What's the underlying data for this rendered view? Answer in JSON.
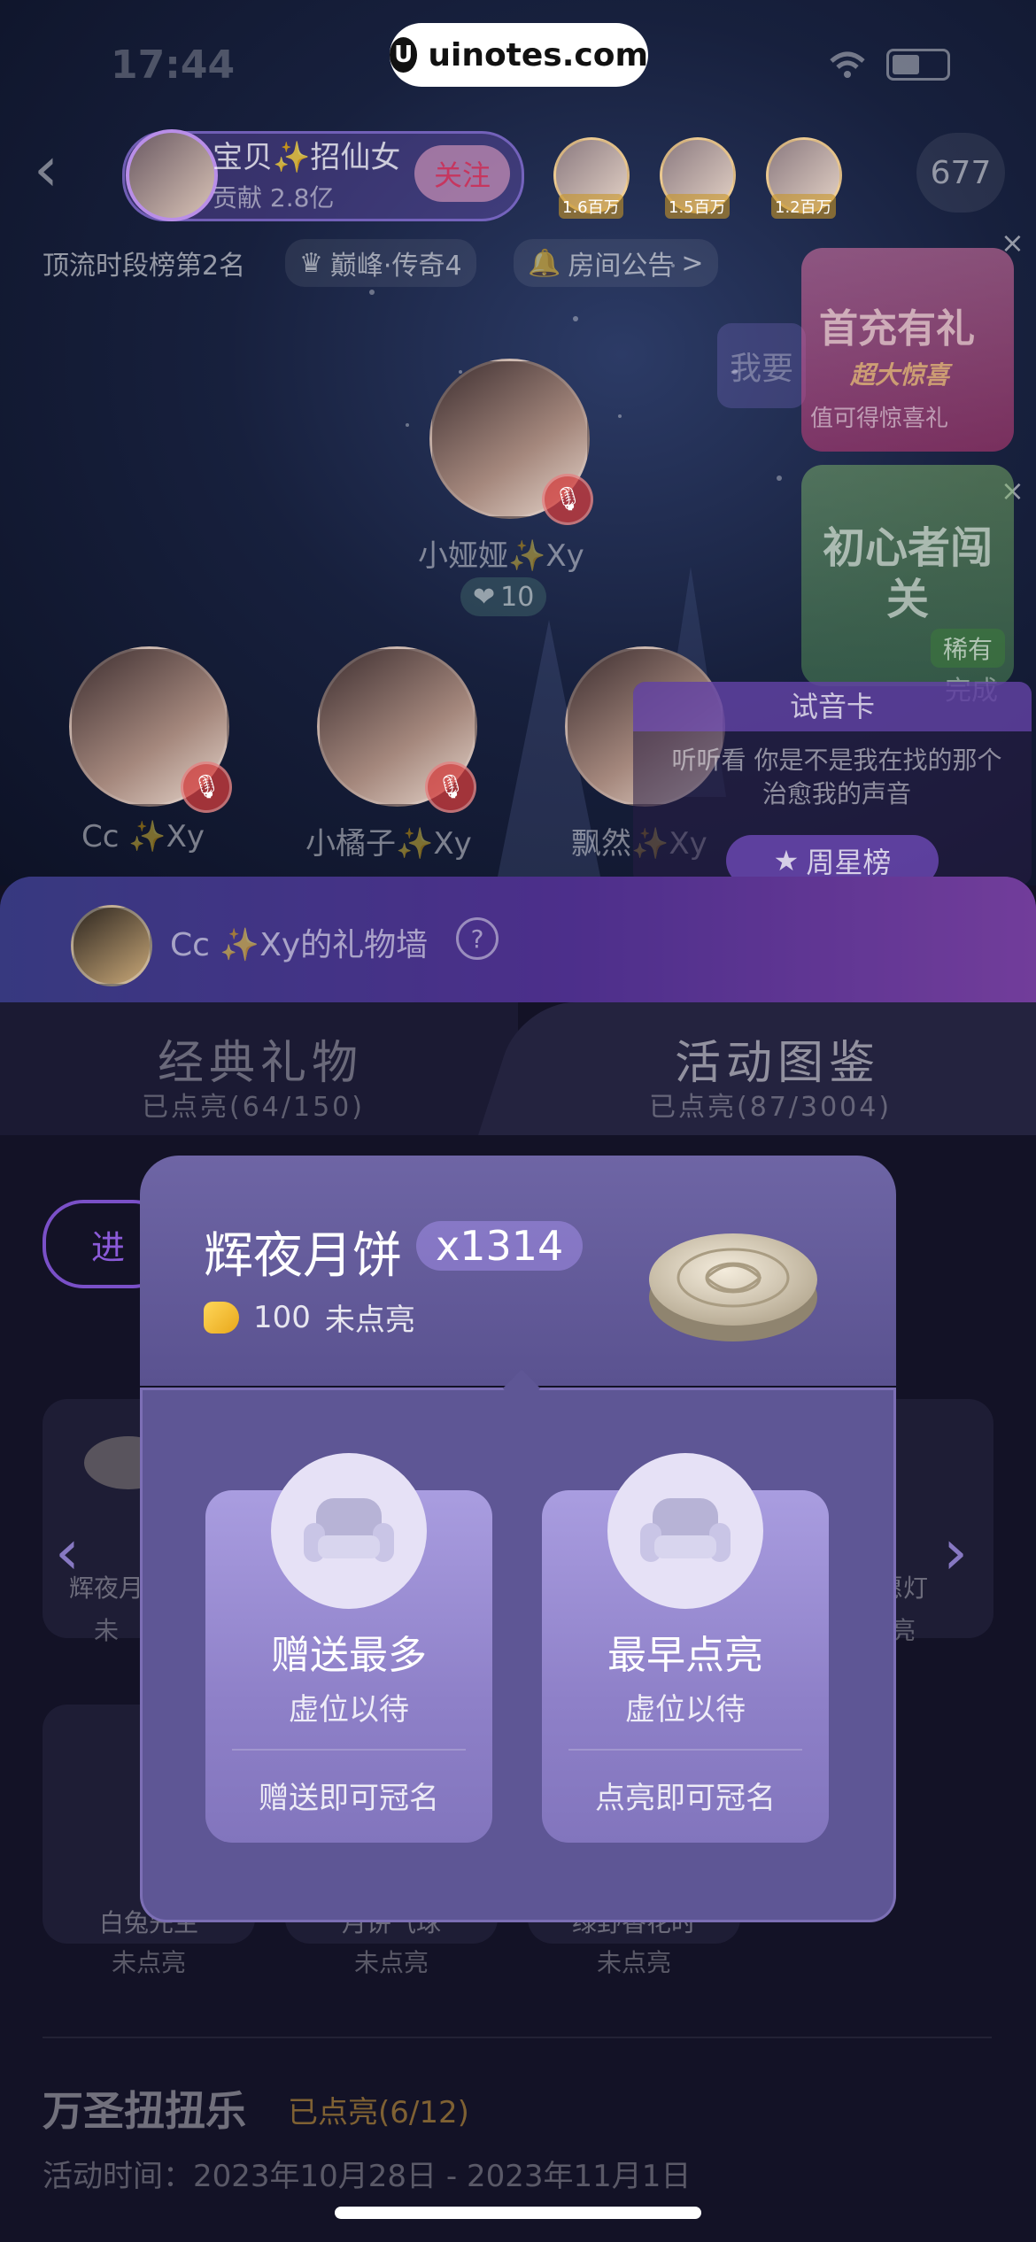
{
  "watermark": {
    "text": "uinotes.com"
  },
  "status_bar": {
    "time": "17:44"
  },
  "room": {
    "host": {
      "name": "宝贝✨招仙女",
      "contribution": "贡献 2.8亿",
      "follow_label": "关注"
    },
    "viewers": [
      {
        "tag": "1.6百万"
      },
      {
        "tag": "1.5百万"
      },
      {
        "tag": "1.2百万"
      }
    ],
    "online_count": "677",
    "rank_text": "顶流时段榜第2名",
    "level_chip": "巅峰·传奇4",
    "announcement": "房间公告",
    "announcement_arrow": ">",
    "main_seat": {
      "name": "小娅娅✨Xy",
      "hearts": "10"
    },
    "seats": [
      {
        "name": "Cc ✨Xy"
      },
      {
        "name": "小橘子✨Xy"
      },
      {
        "name": "飘然✨Xy"
      }
    ],
    "promo_recharge": {
      "title": "首充有礼",
      "subtitle": "超大惊喜",
      "desc": "值可得惊喜礼"
    },
    "promo_rookie": {
      "title": "初心者闯关",
      "tag": "稀有",
      "done": "完成"
    },
    "audition": {
      "title": "试音卡",
      "text": "听听看 你是不是我在找的那个治愈我的声音"
    },
    "week_rank": "周星榜",
    "banner_fragment": "我要"
  },
  "gift_wall": {
    "title": "Cc ✨Xy的礼物墙",
    "tabs": [
      {
        "label": "经典礼物",
        "sub": "已点亮(64/150)"
      },
      {
        "label": "活动图鉴",
        "sub": "已点亮(87/3004)"
      }
    ],
    "filter_label": "进",
    "grid_row1": [
      {
        "name": "辉夜月",
        "state": "未"
      },
      {
        "name": "愿灯",
        "state": "亮"
      }
    ],
    "grid_row2": [
      {
        "name": "白兔先生",
        "state": "未点亮"
      },
      {
        "name": "月饼气球",
        "state": "未点亮"
      },
      {
        "name": "绿野香花时",
        "state": "未点亮"
      }
    ],
    "event": {
      "title": "万圣扭扭乐",
      "progress": "已点亮(6/12)",
      "time": "活动时间：2023年10月28日 - 2023年11月1日"
    }
  },
  "popup": {
    "gift_name": "辉夜月饼",
    "count": "x1314",
    "price": "100",
    "status": "未点亮",
    "cards": [
      {
        "title": "赠送最多",
        "sub": "虚位以待",
        "hint": "赠送即可冠名"
      },
      {
        "title": "最早点亮",
        "sub": "虚位以待",
        "hint": "点亮即可冠名"
      }
    ]
  },
  "colors": {
    "accent_purple": "#7a50c8",
    "popup_bg": "#5e5695",
    "gold": "#e8a71a"
  }
}
